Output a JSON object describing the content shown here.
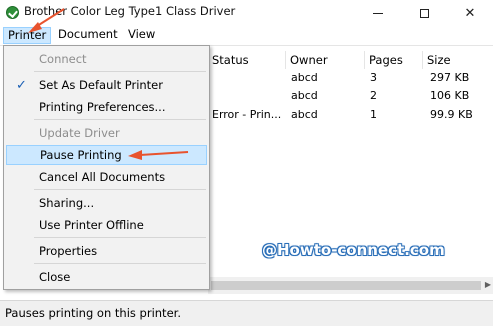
{
  "window": {
    "title": "Brother Color Leg Type1 Class Driver",
    "icon": "printer-check-icon"
  },
  "menubar": {
    "printer": "Printer",
    "document": "Document",
    "view": "View"
  },
  "columns": {
    "status": "Status",
    "owner": "Owner",
    "pages": "Pages",
    "size": "Size"
  },
  "rows": [
    {
      "status": "",
      "owner": "abcd",
      "pages": "3",
      "size": "297 KB"
    },
    {
      "status": "",
      "owner": "abcd",
      "pages": "2",
      "size": "106 KB"
    },
    {
      "status": "Error - Prin...",
      "owner": "abcd",
      "pages": "1",
      "size": "99.9 KB"
    }
  ],
  "printer_menu": {
    "connect": "Connect",
    "set_default": "Set As Default Printer",
    "preferences": "Printing Preferences...",
    "update_driver": "Update Driver",
    "pause": "Pause Printing",
    "cancel_all": "Cancel All Documents",
    "sharing": "Sharing...",
    "offline": "Use Printer Offline",
    "properties": "Properties",
    "close": "Close",
    "checked_item": "set_default",
    "highlighted_item": "pause"
  },
  "watermark": "@Howto-connect.com",
  "status_bar": "Pauses printing on this printer.",
  "colors": {
    "highlight": "#cce8ff",
    "highlight_border": "#99d1ff",
    "arrow": "#e8532e",
    "watermark_outline": "#2b6fb8"
  }
}
